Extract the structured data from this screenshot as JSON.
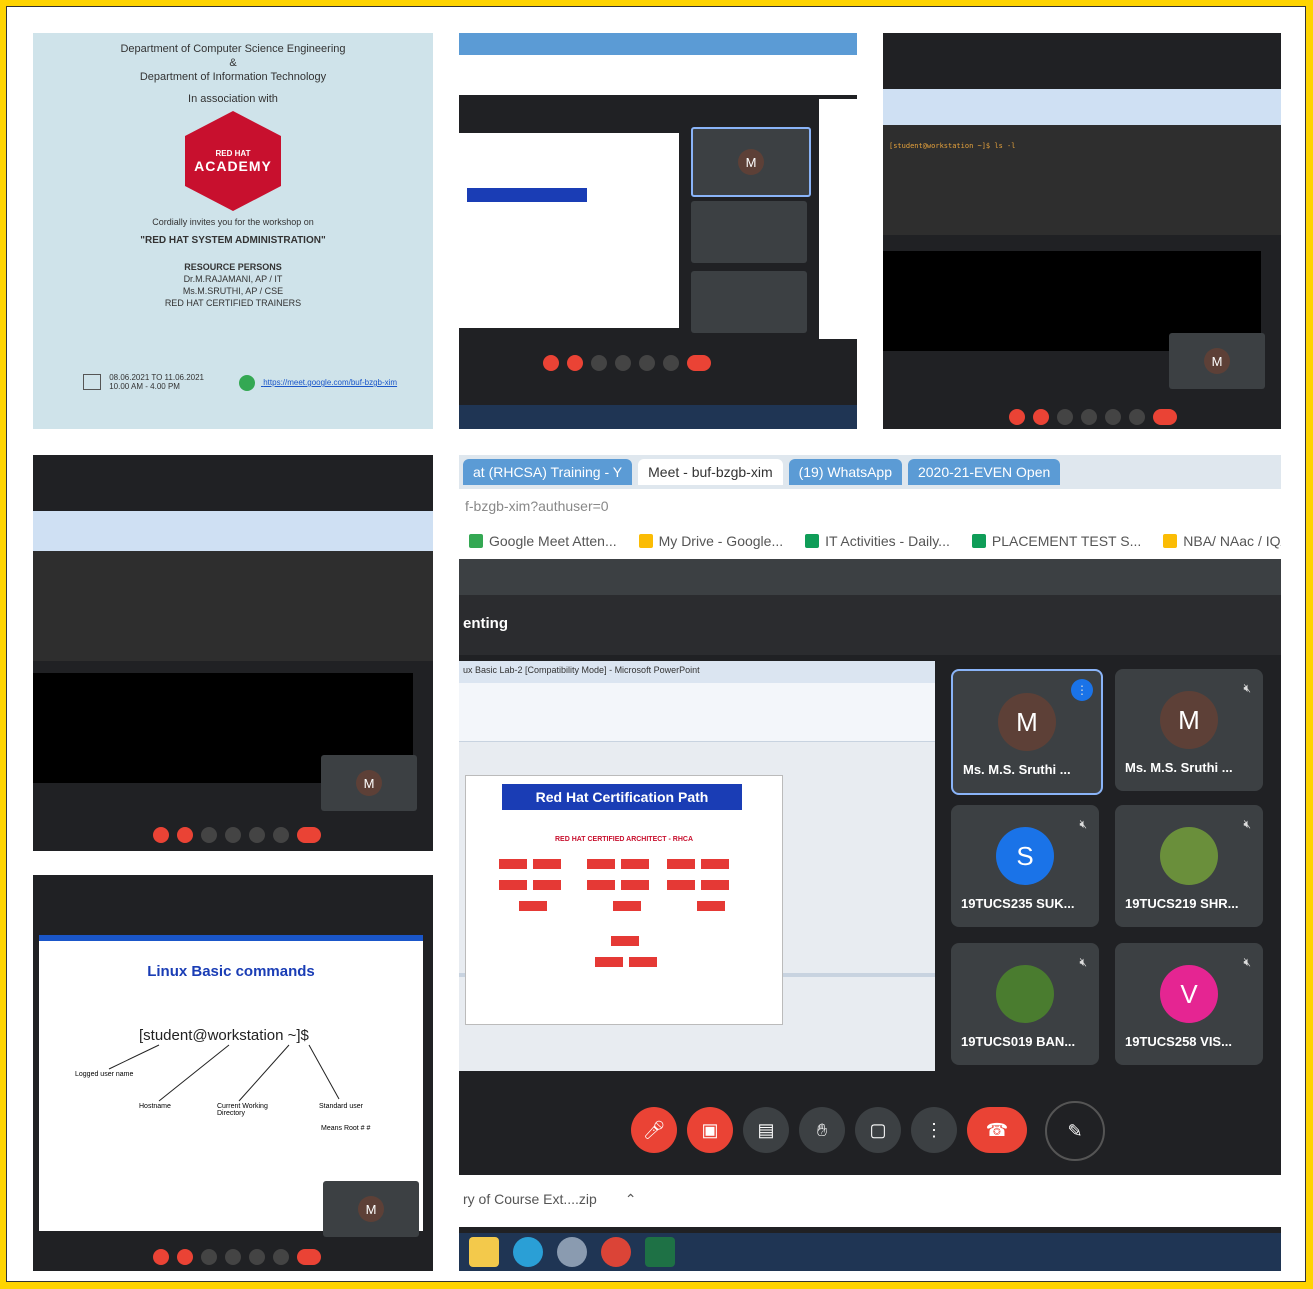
{
  "poster": {
    "dept1": "Department of Computer Science Engineering",
    "amp": "&",
    "dept2": "Department of Information Technology",
    "assoc": "In association with",
    "logo_small": "RED HAT",
    "logo_big": "ACADEMY",
    "organizing": "Cordially invites you for the workshop on",
    "workshop": "\"RED HAT SYSTEM ADMINISTRATION\"",
    "resource": "RESOURCE PERSONS",
    "person1": "Dr.M.RAJAMANI, AP / IT",
    "person2": "Ms.M.SRUTHI, AP / CSE",
    "person3": "RED HAT CERTIFIED TRAINERS",
    "dates": "08.06.2021 TO 11.06.2021",
    "time": "10.00 AM - 4.00 PM",
    "link": "https://meet.google.com/buf-bzgb-xim"
  },
  "big": {
    "tabs": [
      "at (RHCSA) Training - Y",
      "Meet - buf-bzgb-xim",
      "(19) WhatsApp",
      "2020-21-EVEN Open"
    ],
    "url": "f-bzgb-xim?authuser=0",
    "bookmarks": [
      "Google Meet Atten...",
      "My Drive - Google...",
      "IT Activities - Daily...",
      "PLACEMENT TEST S...",
      "NBA/ NAac / IQAC..."
    ],
    "presenting": "enting",
    "ppt_title": "ux Basic Lab-2 [Compatibility Mode] - Microsoft PowerPoint",
    "slide_title": "Red Hat Certification Path",
    "slide_subtitle": "RED HAT CERTIFIED ARCHITECT - RHCA",
    "participants": [
      {
        "initial": "M",
        "name": "Ms. M.S. Sruthi ...",
        "color": "#5d4037"
      },
      {
        "initial": "M",
        "name": "Ms. M.S. Sruthi ...",
        "color": "#5d4037"
      },
      {
        "initial": "S",
        "name": "19TUCS235 SUK...",
        "color": "#1a73e8"
      },
      {
        "initial": "",
        "name": "19TUCS219 SHR...",
        "color": "#6a8f3b"
      },
      {
        "initial": "",
        "name": "19TUCS019 BAN...",
        "color": "#4a7c2f"
      },
      {
        "initial": "V",
        "name": "19TUCS258 VIS...",
        "color": "#e52592"
      }
    ],
    "download": "ry of Course Ext....zip",
    "self_initial": "M"
  },
  "small_screens": {
    "self_initial": "M",
    "term_text": "[student@workstation ~]$ ls -l",
    "linux_title": "Linux Basic commands",
    "prompt": "[student@workstation ~]$",
    "labels": [
      "Logged user name",
      "Hostname",
      "Current Working Directory",
      "Standard user",
      "Means Root # #"
    ]
  },
  "colors": {
    "frame": "#ffd400",
    "meet_dark": "#202124",
    "end_call": "#ea4335",
    "tab_blue": "#5b9bd5",
    "redhat": "#c8102e"
  }
}
